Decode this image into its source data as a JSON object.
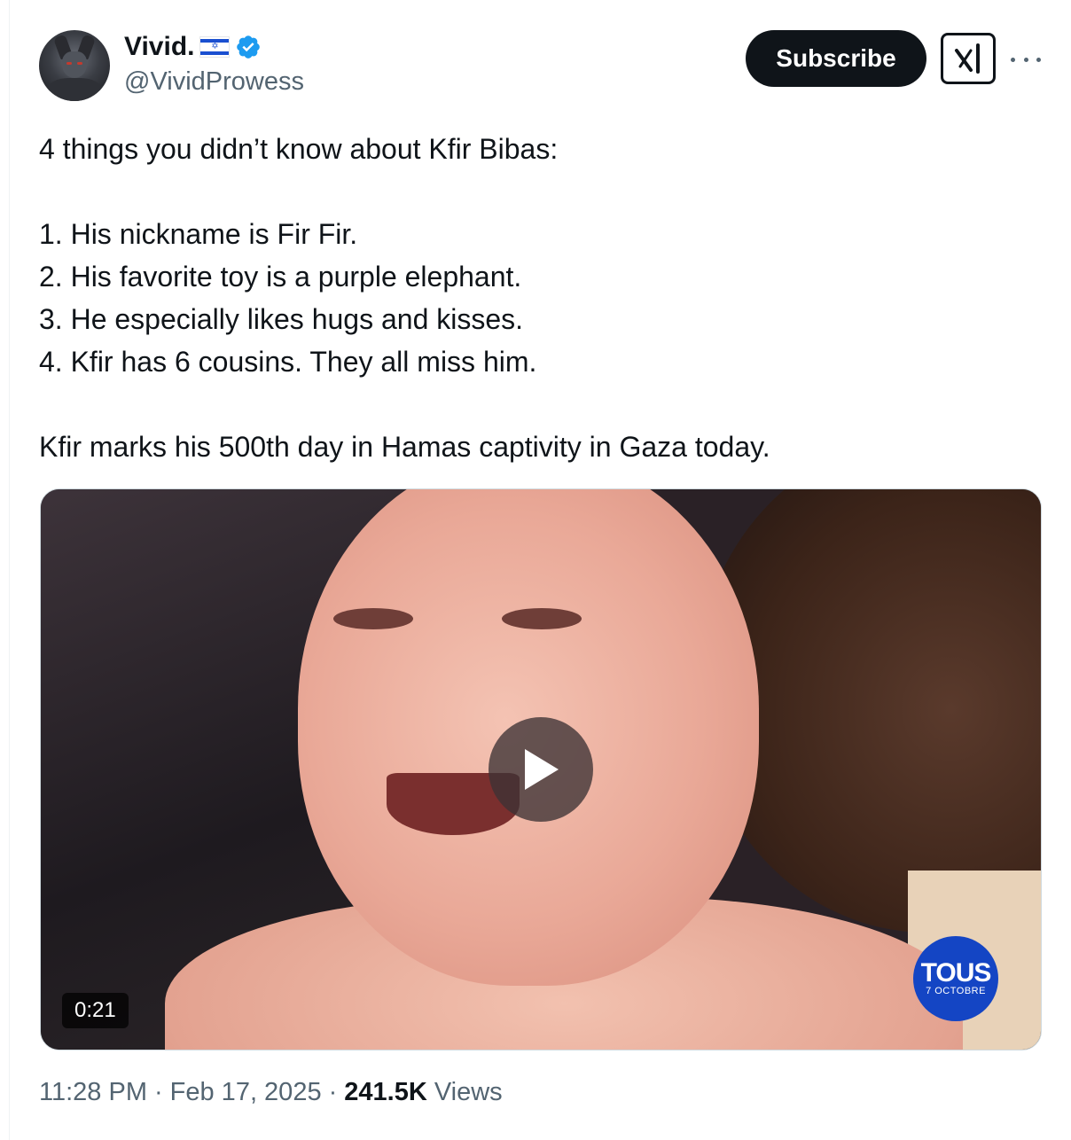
{
  "author": {
    "display_name": "Vivid.",
    "flag_icon": "israel-flag-icon",
    "verified_color": "#1d9bf0",
    "handle": "@VividProwess"
  },
  "header": {
    "subscribe_label": "Subscribe",
    "grok_icon": "grok-icon",
    "more_icon": "more-options-icon"
  },
  "tweet": {
    "intro": "4 things you didn’t know about Kfir Bibas:",
    "items": [
      "1. His nickname is Fir Fir.",
      "2. His favorite toy is a purple elephant.",
      "3. He especially likes hugs and kisses.",
      "4. Kfir has 6 cousins. They all miss him."
    ],
    "closing": "Kfir marks his 500th day in Hamas captivity in Gaza today."
  },
  "media": {
    "duration": "0:21",
    "watermark_title": "TOUS",
    "watermark_sub": "7 OCTOBRE"
  },
  "meta": {
    "time": "11:28 PM",
    "separator": "·",
    "date": "Feb 17, 2025",
    "views_count": "241.5K",
    "views_label": "Views"
  }
}
